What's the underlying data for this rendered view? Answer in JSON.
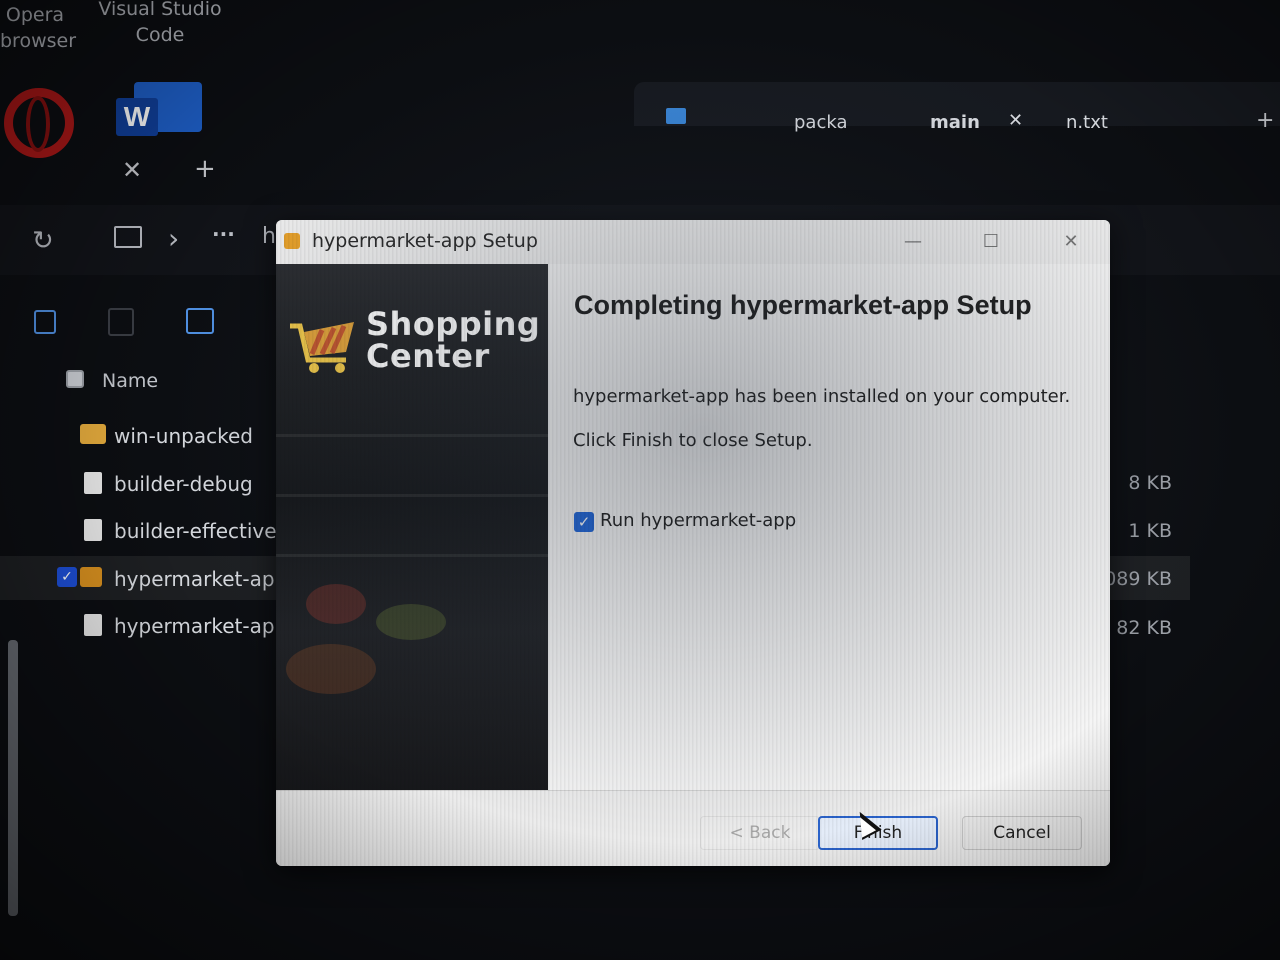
{
  "desktop": {
    "icons": [
      {
        "label_line1": "Opera",
        "label_line2": "browser"
      },
      {
        "label_line1": "Visual Studio",
        "label_line2": "Code"
      }
    ],
    "word_letter": "W"
  },
  "back_window": {
    "tabs": [
      "packa",
      "main",
      "n.txt"
    ],
    "tab_close": "✕",
    "new_tab": "+",
    "close_glyph": "✕",
    "plus_glyph": "+",
    "refresh_glyph": "↻",
    "chevron_glyph": "›",
    "more_glyph": "···",
    "path_fragment": "h",
    "column_name": "Name",
    "files": [
      {
        "name": "win-unpacked",
        "size": "",
        "type": "folder"
      },
      {
        "name": "builder-debug",
        "size": "8 KB",
        "type": "file"
      },
      {
        "name": "builder-effective-cc",
        "size": "1 KB",
        "type": "file"
      },
      {
        "name": "hypermarket-app S",
        "size": "089 KB",
        "type": "app",
        "selected": true
      },
      {
        "name": "hypermarket-app S",
        "size": "82 KB",
        "type": "file"
      }
    ]
  },
  "installer": {
    "window_title": "hypermarket-app Setup",
    "minimize_glyph": "—",
    "maximize_glyph": "☐",
    "close_glyph": "✕",
    "logo_line1": "Shopping",
    "logo_line2": "Center",
    "heading": "Completing hypermarket-app Setup",
    "installed_text": "hypermarket-app has been installed on your computer.",
    "finish_hint": "Click Finish to close Setup.",
    "run_checkbox_label": "Run hypermarket-app",
    "run_checked": true,
    "check_glyph": "✓",
    "buttons": {
      "back": "< Back",
      "finish": "Finish",
      "cancel": "Cancel"
    },
    "accent_color": "#1f64d6"
  }
}
